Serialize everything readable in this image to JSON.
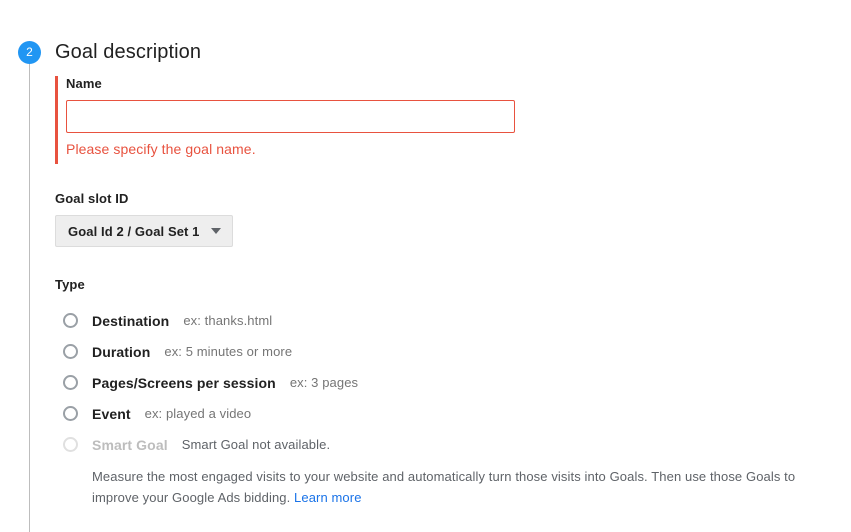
{
  "step": {
    "number": "2",
    "title": "Goal description"
  },
  "name_field": {
    "label": "Name",
    "value": "",
    "placeholder": "",
    "error": "Please specify the goal name."
  },
  "goal_slot": {
    "label": "Goal slot ID",
    "selected": "Goal Id 2 / Goal Set 1"
  },
  "type": {
    "label": "Type",
    "options": [
      {
        "label": "Destination",
        "hint": "ex: thanks.html",
        "disabled": false
      },
      {
        "label": "Duration",
        "hint": "ex: 5 minutes or more",
        "disabled": false
      },
      {
        "label": "Pages/Screens per session",
        "hint": "ex: 3 pages",
        "disabled": false
      },
      {
        "label": "Event",
        "hint": "ex: played a video",
        "disabled": false
      },
      {
        "label": "Smart Goal",
        "hint": "Smart Goal not available.",
        "disabled": true
      }
    ],
    "smart_goal_description": "Measure the most engaged visits to your website and automatically turn those visits into Goals. Then use those Goals to improve your Google Ads bidding.",
    "learn_more_label": "Learn more"
  },
  "colors": {
    "accent_blue": "#2196f3",
    "error_red": "#e8523f",
    "link_blue": "#1a73e8"
  }
}
